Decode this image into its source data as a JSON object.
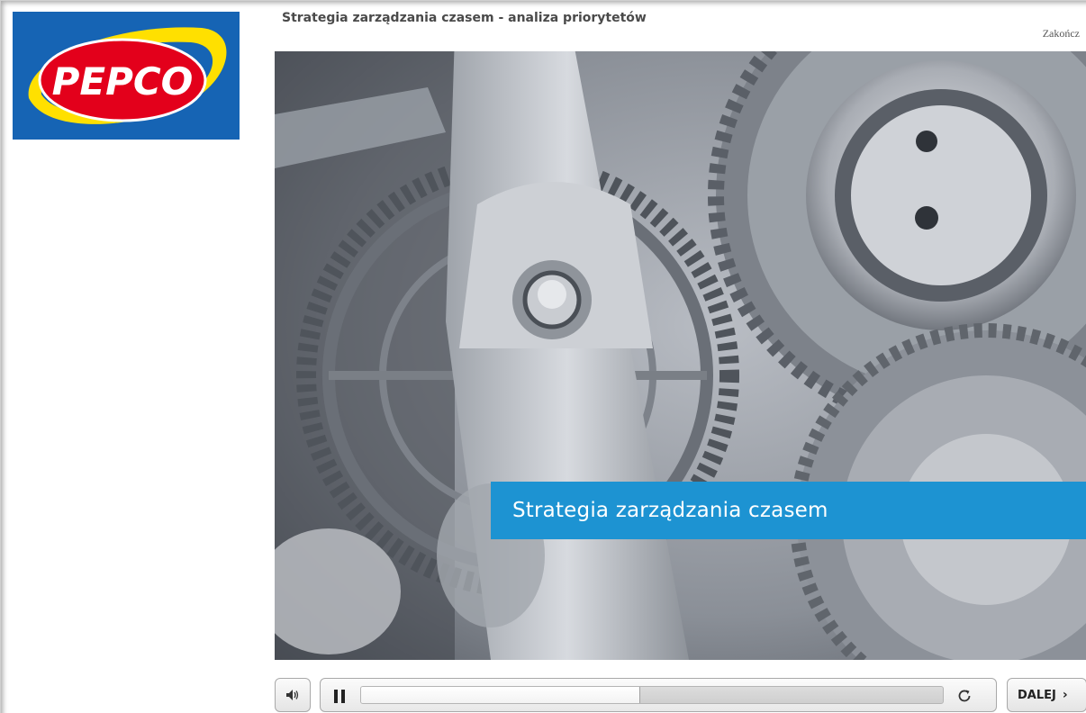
{
  "brand": {
    "logo_text": "PEPCO",
    "colors": {
      "blue": "#1664b4",
      "red": "#e3001b",
      "yellow": "#ffe000"
    }
  },
  "header": {
    "course_title": "Strategia zarządzania czasem - analiza priorytetów",
    "exit_label": "Zakończ"
  },
  "slide": {
    "image": "gears-macro-photo",
    "banner_text": "Strategia zarządzania czasem",
    "banner_color": "#1d93d2"
  },
  "player": {
    "volume_icon": "speaker-icon",
    "pause_icon": "pause-icon",
    "replay_icon": "replay-icon",
    "progress": 0.48,
    "next_label": "DALEJ",
    "next_icon": "chevron-right-icon"
  }
}
